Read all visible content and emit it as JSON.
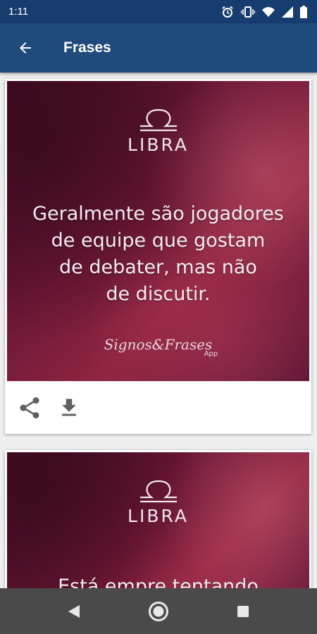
{
  "status_bar": {
    "time": "1:11",
    "icons": [
      "alarm-icon",
      "vibrate-icon",
      "wifi-icon",
      "signal-icon",
      "battery-icon"
    ]
  },
  "app_bar": {
    "back_icon": "arrow-back-icon",
    "title": "Frases"
  },
  "cards": [
    {
      "sign": "LIBRA",
      "quote_lines": [
        "Geralmente são jogadores",
        "de equipe que gostam",
        "de debater, mas não",
        "de discutir."
      ],
      "watermark": "Signos&Frases",
      "watermark_sub": "App",
      "actions": [
        "share-icon",
        "download-icon"
      ]
    },
    {
      "sign": "LIBRA",
      "quote_lines": [
        "Está empre tentando"
      ]
    }
  ],
  "nav_bar": {
    "buttons": [
      "back-triangle-icon",
      "home-circle-icon",
      "recents-square-icon"
    ]
  },
  "colors": {
    "status_bar": "#173c70",
    "app_bar": "#1e4a7c",
    "background": "#efefef",
    "nav_bar": "#4a4a4a"
  }
}
